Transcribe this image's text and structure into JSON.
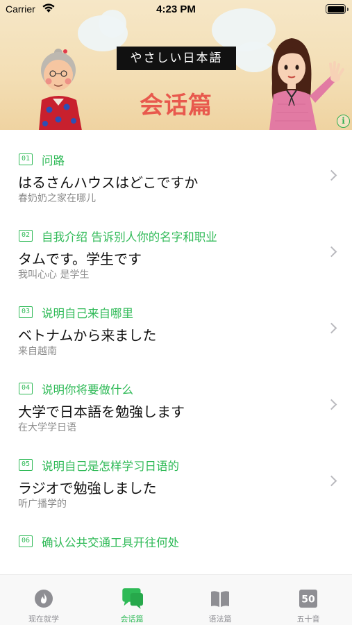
{
  "status_bar": {
    "carrier": "Carrier",
    "time": "4:23 PM"
  },
  "banner": {
    "title": "やさしい日本語",
    "subtitle": "会话篇"
  },
  "lessons": [
    {
      "num": "01",
      "topic": "问路",
      "jp": "はるさんハウスはどこですか",
      "cn": "春奶奶之家在哪儿"
    },
    {
      "num": "02",
      "topic": "自我介绍 告诉别人你的名字和职业",
      "jp": "タムです。学生です",
      "cn": "我叫心心 是学生"
    },
    {
      "num": "03",
      "topic": "说明自己来自哪里",
      "jp": "ベトナムから来ました",
      "cn": "来自越南"
    },
    {
      "num": "04",
      "topic": "说明你将要做什么",
      "jp": "大学で日本語を勉強します",
      "cn": "在大学学日语"
    },
    {
      "num": "05",
      "topic": "说明自己是怎样学习日语的",
      "jp": "ラジオで勉強しました",
      "cn": "听广播学的"
    },
    {
      "num": "06",
      "topic": "确认公共交通工具开往何处",
      "jp": "",
      "cn": ""
    }
  ],
  "tabs": [
    {
      "label": "现在就学",
      "icon": "flame-icon",
      "badge": ""
    },
    {
      "label": "会话篇",
      "icon": "chat-bubbles-icon",
      "badge": ""
    },
    {
      "label": "语法篇",
      "icon": "book-icon",
      "badge": ""
    },
    {
      "label": "五十音",
      "icon": "kana-50-icon",
      "badge": "50"
    }
  ],
  "active_tab": 1,
  "colors": {
    "accent": "#2fba57",
    "subtitle_red": "#e8594d",
    "banner_bg": "#f3deb4",
    "inactive_tab": "#8e8e93"
  }
}
